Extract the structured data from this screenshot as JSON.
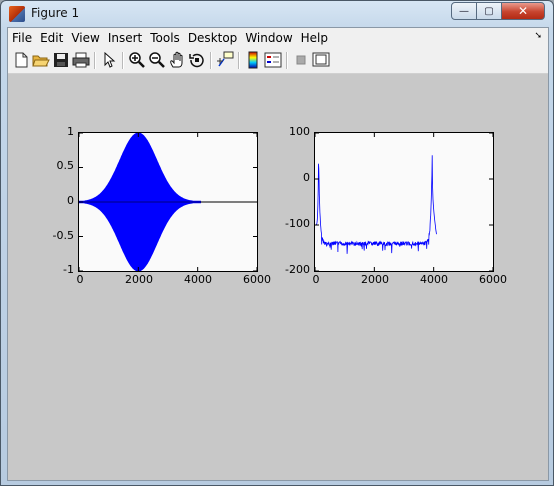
{
  "window": {
    "title": "Figure 1",
    "min_glyph": "—",
    "max_glyph": "▢",
    "close_glyph": "✕"
  },
  "menu": [
    "File",
    "Edit",
    "View",
    "Insert",
    "Tools",
    "Desktop",
    "Window",
    "Help"
  ],
  "menu_arrow": "➘",
  "toolbar": [
    "new-figure-icon",
    "open-file-icon",
    "save-icon",
    "print-icon",
    "pointer-icon",
    "zoom-in-icon",
    "zoom-out-icon",
    "pan-hand-icon",
    "rotate-3d-icon",
    "data-cursor-icon",
    "colorbar-icon",
    "legend-icon",
    "hide-plot-tools-icon",
    "show-plot-tools-icon"
  ],
  "colors": {
    "signal": "#0000ff",
    "figure_bg": "#c8c8c8",
    "axes_bg": "#fafafa"
  },
  "chart_data": [
    {
      "type": "line",
      "title": "",
      "xlabel": "",
      "ylabel": "",
      "xlim": [
        0,
        6000
      ],
      "ylim": [
        -1,
        1
      ],
      "xticks": [
        "0",
        "2000",
        "4000",
        "6000"
      ],
      "yticks": [
        "1",
        "0.5",
        "0",
        "-0.5",
        "-1"
      ],
      "series": [
        {
          "envelope": "gaussian",
          "center": 2000,
          "peak": 1,
          "x_start": 0,
          "x_end": 4096,
          "x_axis_end": 6000
        }
      ]
    },
    {
      "type": "line",
      "title": "",
      "xlabel": "",
      "ylabel": "",
      "xlim": [
        0,
        6000
      ],
      "ylim": [
        -200,
        100
      ],
      "xticks": [
        "0",
        "2000",
        "4000",
        "6000"
      ],
      "yticks": [
        "100",
        "0",
        "-100",
        "-200"
      ],
      "series": [
        {
          "x_start": 0,
          "x_end": 4096,
          "peaks": [
            {
              "x": 120,
              "y": 55
            },
            {
              "x": 3950,
              "y": 55
            }
          ],
          "floor": -140,
          "edge_low": -100,
          "edge_high": -120
        }
      ]
    }
  ]
}
